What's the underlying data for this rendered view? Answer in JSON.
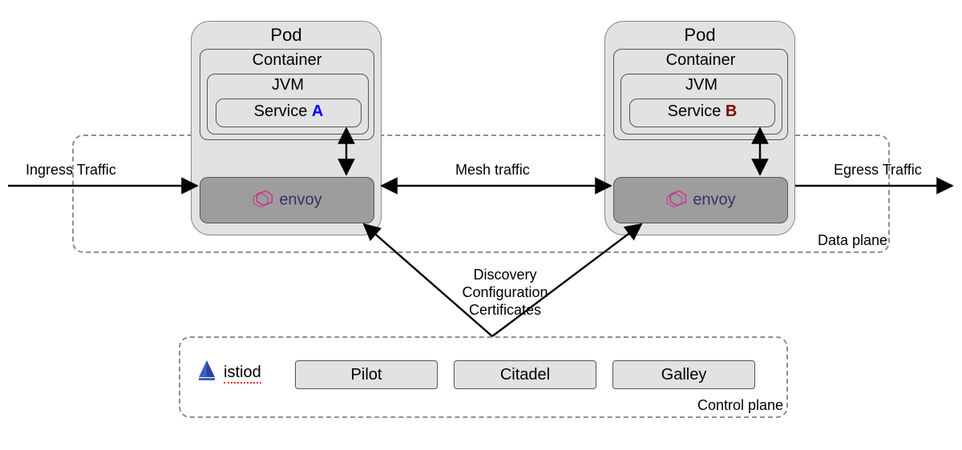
{
  "layout": {
    "dataPlane": {
      "label": "Data plane"
    },
    "controlPlane": {
      "label": "Control plane"
    },
    "podA": {
      "title": "Pod",
      "container": "Container",
      "jvm": "JVM",
      "service": {
        "prefix": "Service ",
        "name": "A",
        "color": "#0000FF"
      }
    },
    "podB": {
      "title": "Pod",
      "container": "Container",
      "jvm": "JVM",
      "service": {
        "prefix": "Service ",
        "name": "B",
        "color": "#800000"
      }
    },
    "envoy": {
      "label": "envoy"
    },
    "traffic": {
      "ingress": "Ingress Traffic",
      "mesh": "Mesh traffic",
      "egress": "Egress Traffic"
    },
    "middle": {
      "discovery": "Discovery",
      "configuration": "Configuration",
      "certificates": "Certificates"
    },
    "control": {
      "istiod": "istiod",
      "pilot": "Pilot",
      "citadel": "Citadel",
      "galley": "Galley"
    }
  }
}
